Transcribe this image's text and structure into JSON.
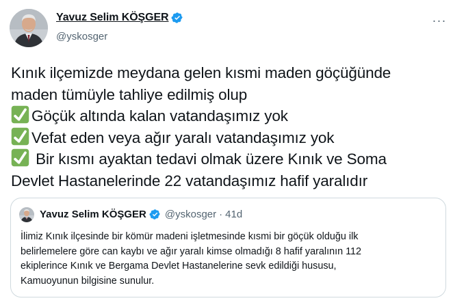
{
  "author": {
    "display_name": "Yavuz Selim KÖŞGER",
    "handle": "@yskosger",
    "verified_icon": "verified-badge-icon",
    "avatar": "profile-photo"
  },
  "menu": {
    "more_label": "···"
  },
  "tweet": {
    "lines": [
      {
        "check": false,
        "text": "Kınık ilçemizde meydana gelen kısmi maden göçüğünde"
      },
      {
        "check": false,
        "text": "maden tümüyle tahliye edilmiş olup"
      },
      {
        "check": true,
        "text": "Göçük altında kalan vatandaşımız yok"
      },
      {
        "check": true,
        "text": "Vefat eden veya ağır yaralı vatandaşımız yok"
      },
      {
        "check": true,
        "text": " Bir kısmı ayaktan tedavi olmak üzere Kınık ve Soma"
      },
      {
        "check": false,
        "text": "Devlet Hastanelerinde 22 vatandaşımız hafif yaralıdır"
      }
    ],
    "check_icon": "white-check-mark-emoji"
  },
  "quoted_tweet": {
    "display_name": "Yavuz Selim KÖŞGER",
    "handle": "@yskosger",
    "separator": "·",
    "time": "41d",
    "lines": [
      "İlimiz Kınık ilçesinde bir kömür madeni işletmesinde kısmi bir göçük olduğu ilk",
      "belirlemelere göre can kaybı ve ağır yaralı kimse olmadığı 8 hafif yaralının 112",
      "ekiplerince Kınık ve Bergama Devlet Hastanelerine sevk edildiği hususu,",
      "Kamuoyunun bilgisine sunulur."
    ]
  },
  "colors": {
    "text_primary": "#0f1419",
    "text_secondary": "#536471",
    "verified_blue": "#1d9bf0",
    "check_green": "#77b255",
    "border": "#cfd9de"
  }
}
